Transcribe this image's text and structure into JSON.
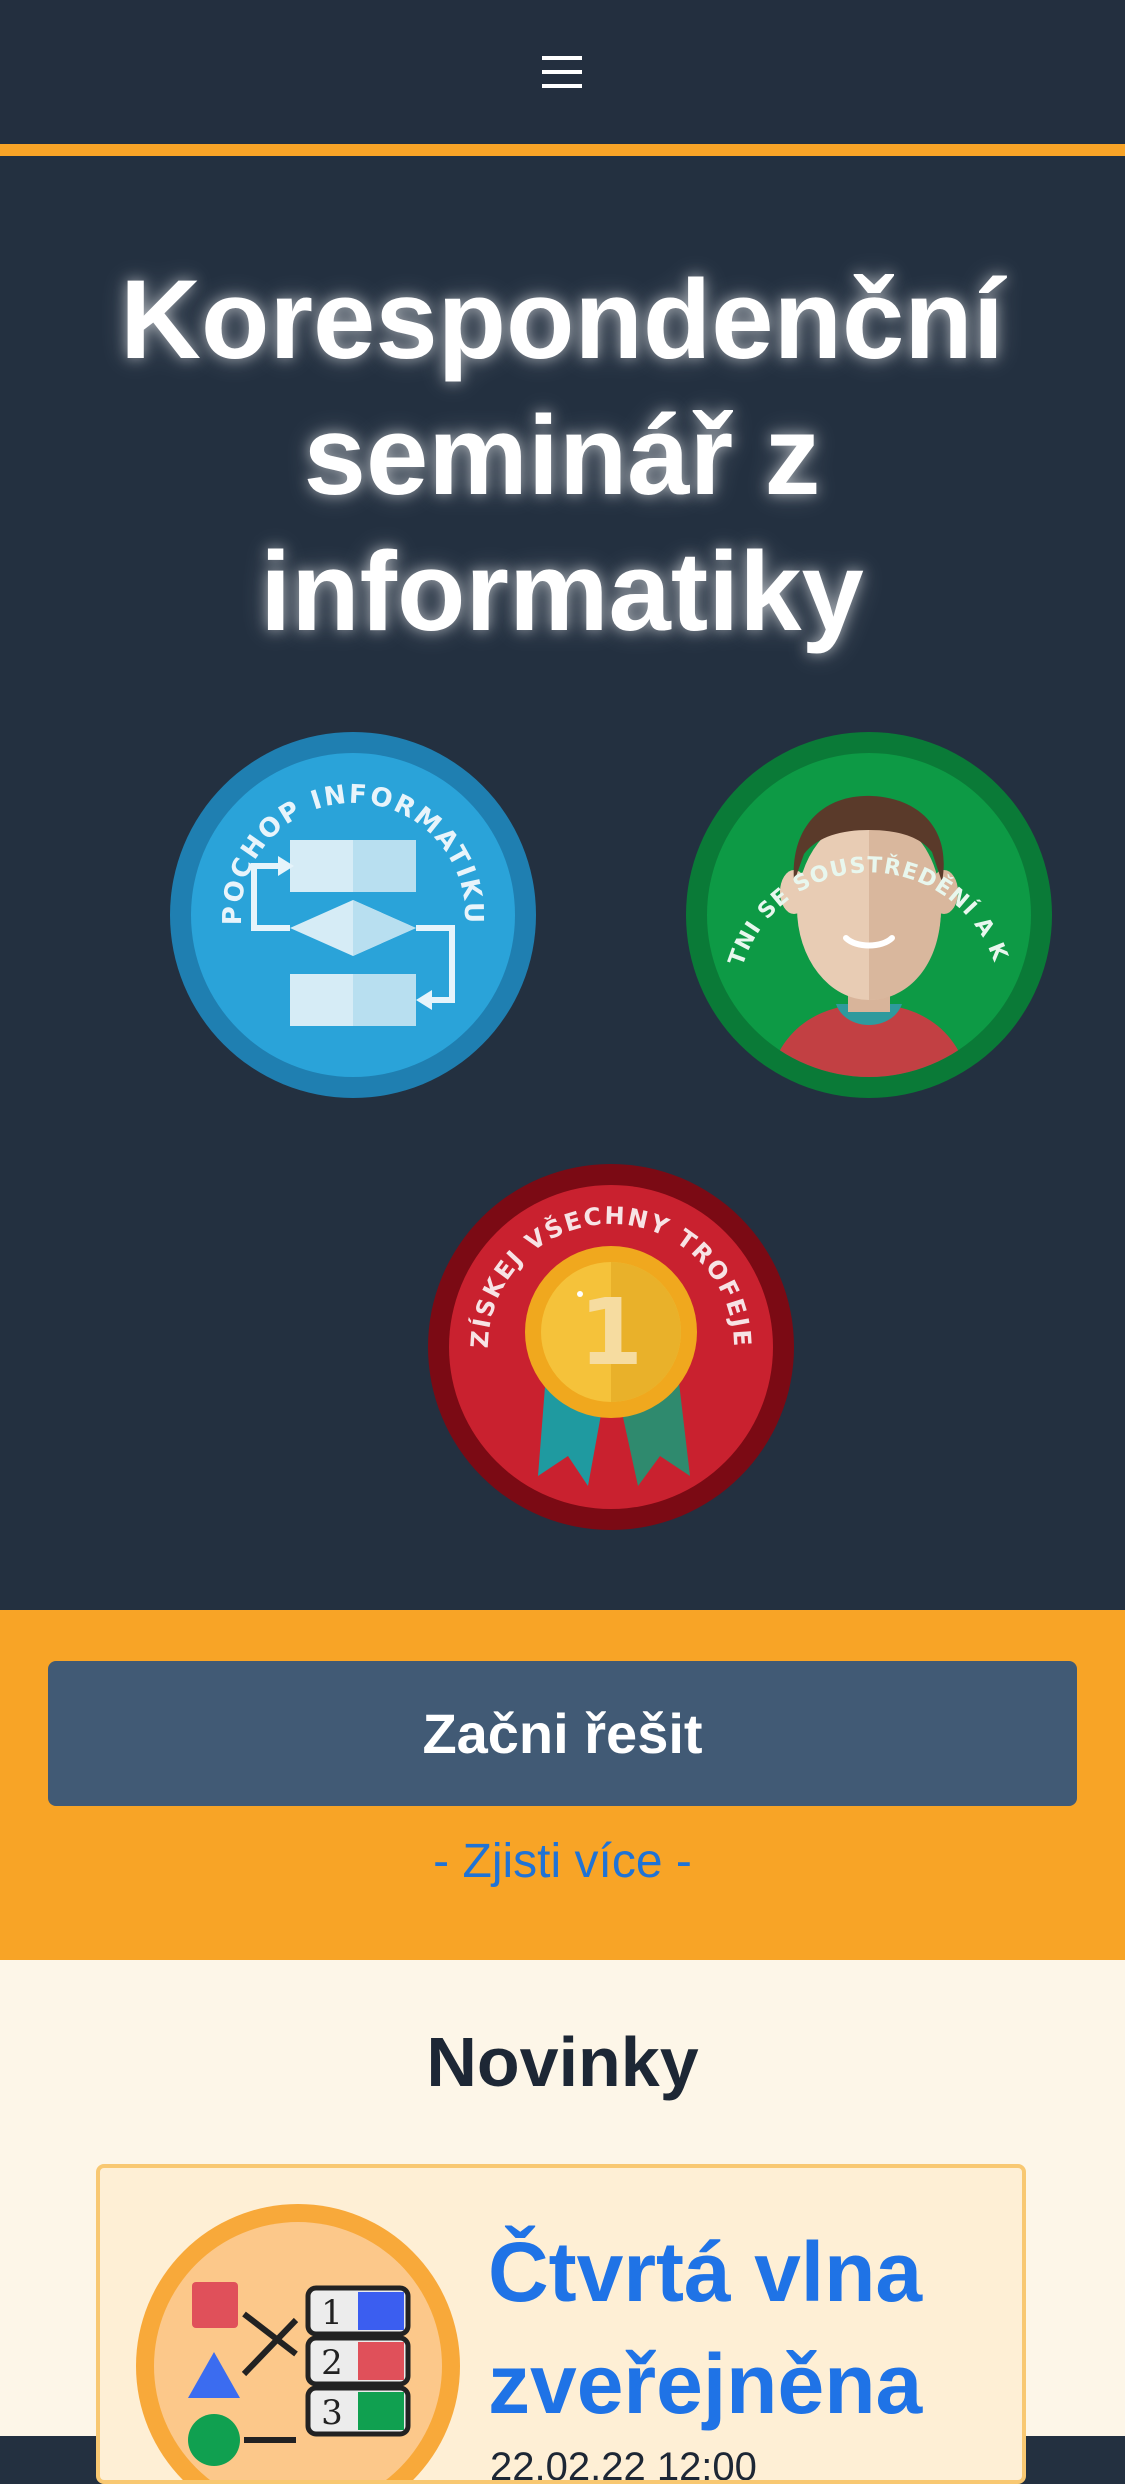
{
  "header": {
    "menu_icon": "hamburger-menu-icon",
    "accent_color": "#f8a427",
    "background": "#232f3f"
  },
  "hero": {
    "title": "Korespondenční seminář z informatiky",
    "badges": [
      {
        "label": "POCHOP INFORMATIKU",
        "icon": "flowchart-icon",
        "color": "#2aa3d9"
      },
      {
        "label": "ZÚČASTNI SE SOUSTŘEDĚNÍ A KSÍLETŮ",
        "icon": "person-icon",
        "color": "#0d9a45"
      },
      {
        "label": "ZÍSKEJ VŠECHNY TROFEJE",
        "icon": "medal-icon",
        "color": "#c9212f"
      }
    ]
  },
  "cta": {
    "start_label": "Začni řešit",
    "more_label": "- Zjisti více -",
    "button_color": "#415a75",
    "background": "#f8a426"
  },
  "news": {
    "heading": "Novinky",
    "items": [
      {
        "title": "Čtvrtá vlna zveřejněna",
        "date": "22.02.22 12:00",
        "image": "sorting-task-icon"
      }
    ]
  }
}
